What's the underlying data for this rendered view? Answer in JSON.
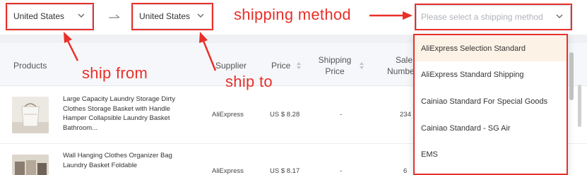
{
  "filters": {
    "ship_from": {
      "value": "United States"
    },
    "ship_to": {
      "value": "United States"
    },
    "shipping_method": {
      "placeholder": "Please select a shipping method"
    }
  },
  "table": {
    "headers": {
      "products": "Products",
      "supplier": "Supplier",
      "price": "Price",
      "shipping_price_line1": "Shipping",
      "shipping_price_line2": "Price",
      "sale_line1": "Sale",
      "sale_line2": "Number"
    },
    "rows": [
      {
        "name": "Large Capacity Laundry Storage Dirty Clothes Storage Basket with Handle Hamper Collapsible Laundry Basket Bathroom...",
        "supplier": "AliExpress",
        "price": "US $ 8.28",
        "shipping": "-",
        "sales": "234"
      },
      {
        "name": "Wall Hanging Clothes Organizer Bag Laundry Basket Foldable",
        "supplier": "AliExpress",
        "price": "US $ 8.17",
        "shipping": "-",
        "sales": "6"
      }
    ]
  },
  "dropdown": {
    "options": [
      "AliExpress Selection Standard",
      "AliExpress Standard Shipping",
      "Cainiao Standard For Special Goods",
      "Cainiao Standard - SG Air",
      "EMS"
    ]
  },
  "annotations": {
    "ship_from": "ship from",
    "ship_to": "ship to",
    "shipping_method": "shipping method"
  },
  "colors": {
    "annotation_red": "#e8302a",
    "highlight_option": "#fdf2e6"
  },
  "icons": [
    "chevron-down-icon",
    "arrow-right-icon",
    "sort-icon"
  ]
}
